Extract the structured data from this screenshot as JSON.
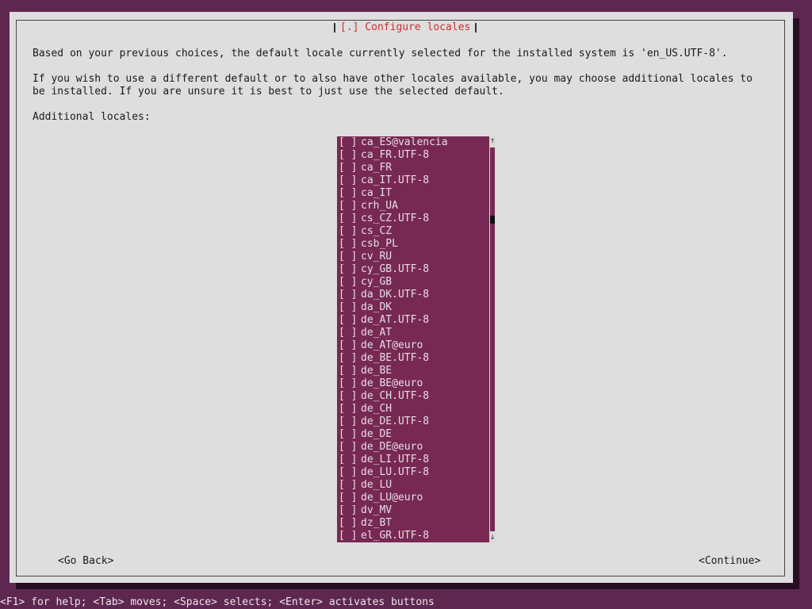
{
  "dialog": {
    "title": "[.] Configure locales",
    "paragraph1": "Based on your previous choices, the default locale currently selected for the installed system is 'en_US.UTF-8'.",
    "paragraph2_line1": "If you wish to use a different default or to also have other locales available, you may choose additional locales to",
    "paragraph2_line2": "be installed. If you are unsure it is best to just use the selected default.",
    "list_label": "Additional locales:",
    "checkbox_glyph": "[ ]",
    "locales": [
      "ca_ES@valencia",
      "ca_FR.UTF-8",
      "ca_FR",
      "ca_IT.UTF-8",
      "ca_IT",
      "crh_UA",
      "cs_CZ.UTF-8",
      "cs_CZ",
      "csb_PL",
      "cv_RU",
      "cy_GB.UTF-8",
      "cy_GB",
      "da_DK.UTF-8",
      "da_DK",
      "de_AT.UTF-8",
      "de_AT",
      "de_AT@euro",
      "de_BE.UTF-8",
      "de_BE",
      "de_BE@euro",
      "de_CH.UTF-8",
      "de_CH",
      "de_DE.UTF-8",
      "de_DE",
      "de_DE@euro",
      "de_LI.UTF-8",
      "de_LU.UTF-8",
      "de_LU",
      "de_LU@euro",
      "dv_MV",
      "dz_BT",
      "el_GR.UTF-8"
    ],
    "focused_index": 31,
    "scroll": {
      "up_glyph": "↑",
      "down_glyph": "↓"
    },
    "buttons": {
      "go_back": "<Go Back>",
      "continue": "<Continue>"
    }
  },
  "footer": {
    "help_text": "<F1> for help; <Tab> moves; <Space> selects; <Enter> activates buttons"
  },
  "colors": {
    "background": "#5e2750",
    "dialog": "#dedede",
    "list_background": "#772953",
    "title_text": "#c8322f",
    "cursor": "#e0392c"
  }
}
